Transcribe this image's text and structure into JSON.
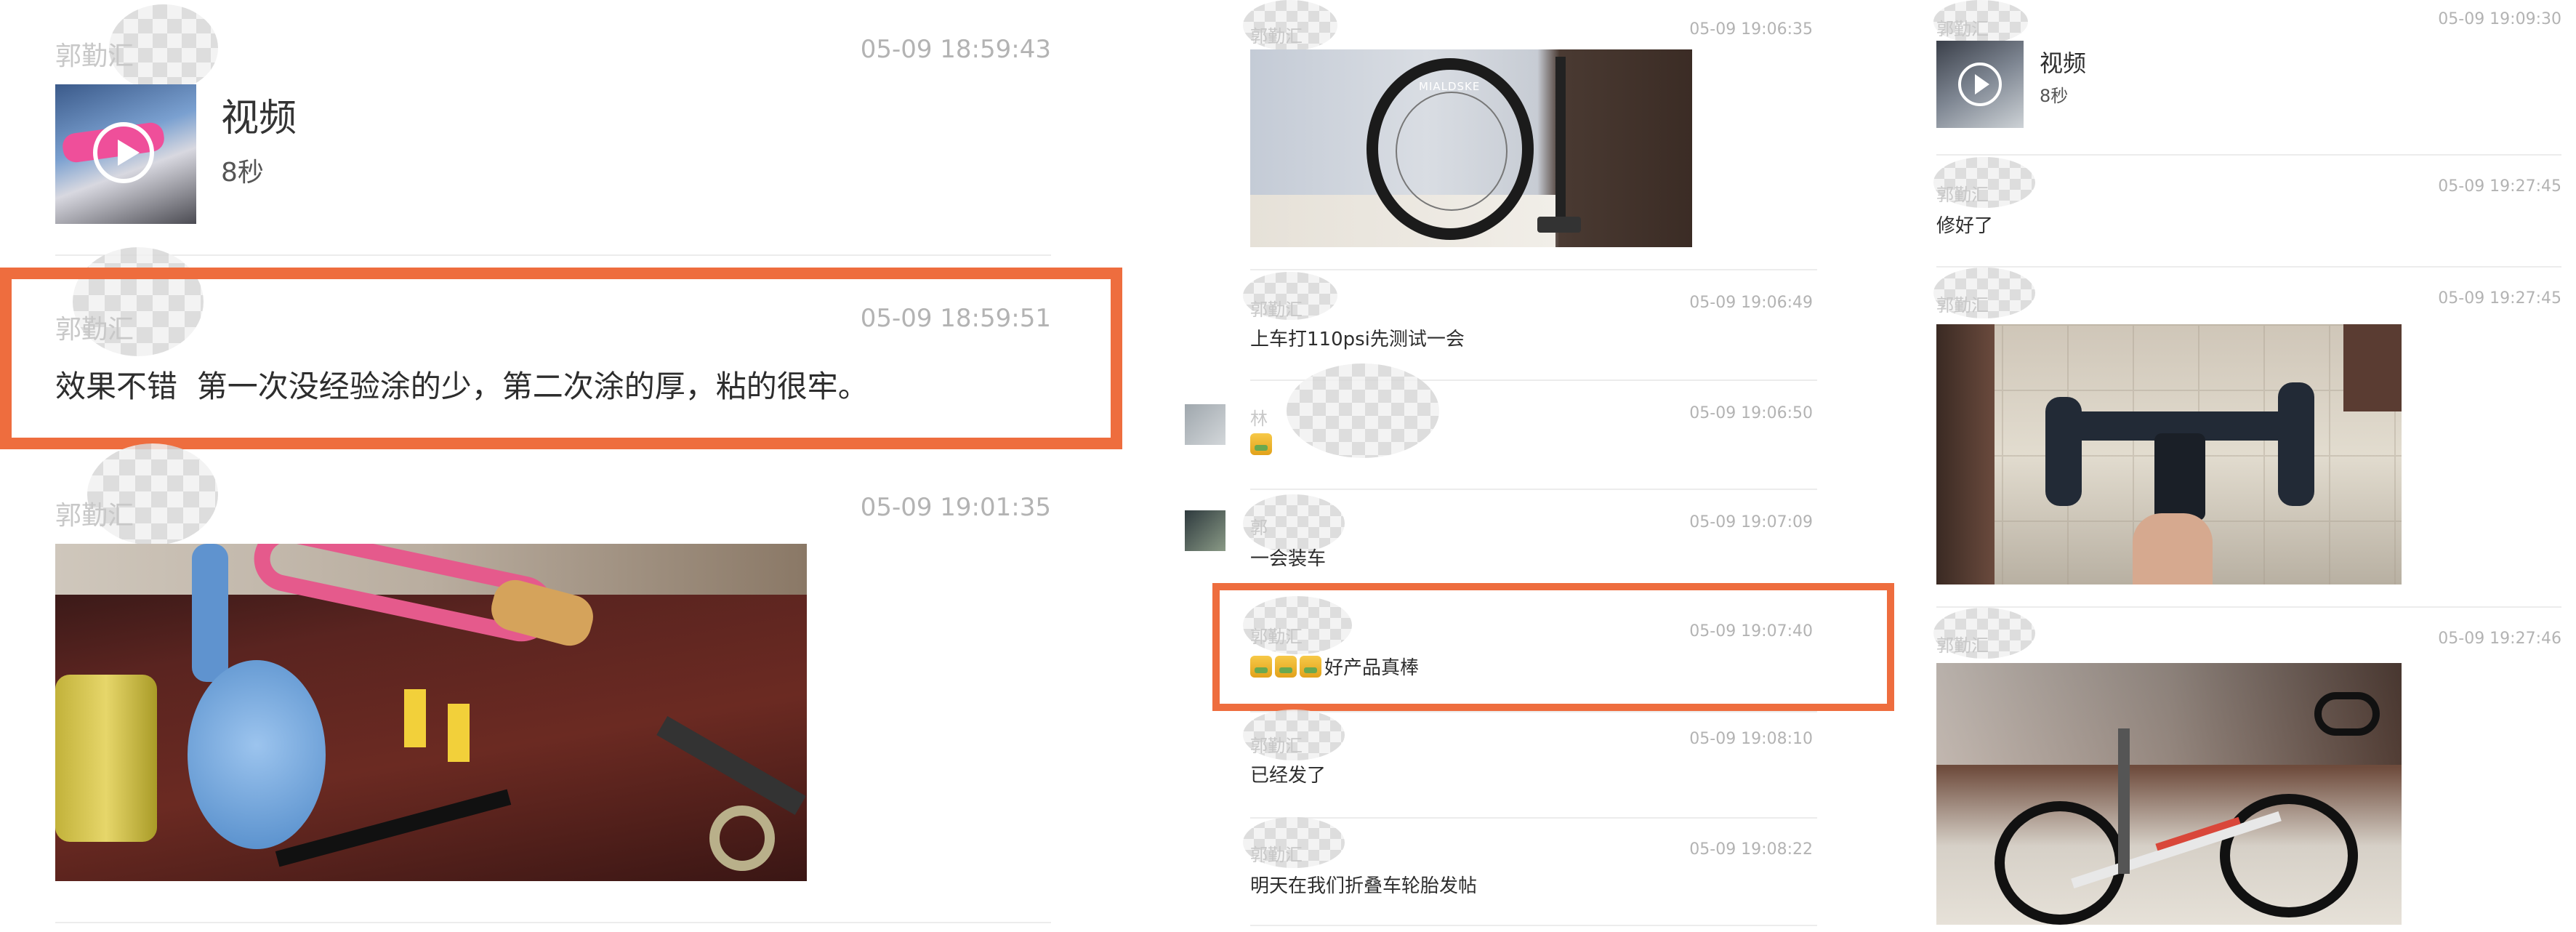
{
  "left_column": {
    "msg1": {
      "sender": "郭勤汇",
      "time": "05-09 18:59:43",
      "video_title": "视频",
      "video_duration": "8秒"
    },
    "msg2": {
      "sender": "郭勤汇",
      "time": "05-09 18:59:51",
      "text": "效果不错  第一次没经验涂的少，第二次涂的厚，粘的很牢。"
    },
    "msg3": {
      "sender": "郭勤汇",
      "time": "05-09 19:01:35"
    }
  },
  "middle_column": {
    "msg1": {
      "sender": "郭勤汇",
      "time": "05-09 19:06:35",
      "wheel_brand": "MIALDSKE"
    },
    "msg2": {
      "sender": "郭勤汇",
      "time": "05-09 19:06:49",
      "text": "上车打110psi先测试一会"
    },
    "msg3": {
      "sender": "林",
      "time": "05-09 19:06:50"
    },
    "msg4": {
      "sender": "郭",
      "time": "05-09 19:07:09",
      "text": "一会装车"
    },
    "msg5": {
      "sender": "郭勤汇",
      "time": "05-09 19:07:40",
      "text": "好产品真棒"
    },
    "msg6": {
      "sender": "郭勤汇",
      "time": "05-09 19:08:10",
      "text": "已经发了"
    },
    "msg7": {
      "sender": "郭勤汇",
      "time": "05-09 19:08:22",
      "text": "明天在我们折叠车轮胎发帖"
    }
  },
  "right_column": {
    "msg1": {
      "sender": "郭勤汇",
      "time": "05-09 19:09:30",
      "video_title": "视频",
      "video_duration": "8秒"
    },
    "msg2": {
      "sender": "郭勤汇",
      "time": "05-09 19:27:45",
      "text": "修好了"
    },
    "msg3": {
      "sender": "郭勤汇",
      "time": "05-09 19:27:45"
    },
    "msg4": {
      "sender": "郭勤汇",
      "time": "05-09 19:27:46"
    }
  },
  "colors": {
    "highlight": "#ee6d3e",
    "timestamp": "#b3b3b3",
    "divider": "#ececec"
  }
}
